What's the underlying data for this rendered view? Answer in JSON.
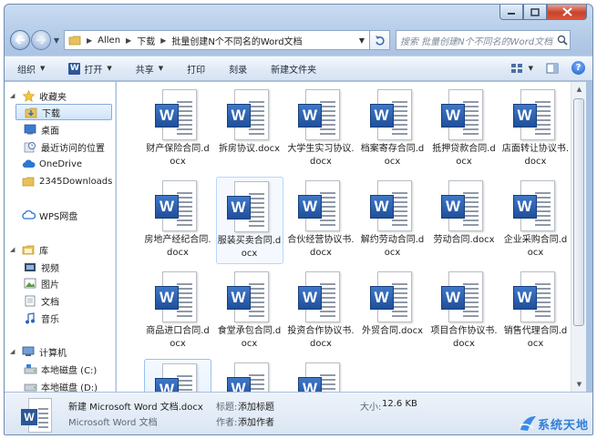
{
  "address": {
    "crumbs": [
      "Allen",
      "下载",
      "批量创建N个不同名的Word文档"
    ]
  },
  "search": {
    "placeholder": "搜索 批量创建N个不同名的Word文档"
  },
  "toolbar": {
    "organize": "组织",
    "open": "打开",
    "share": "共享",
    "print": "打印",
    "burn": "刻录",
    "new_folder": "新建文件夹"
  },
  "sidebar": {
    "favorites": "收藏夹",
    "downloads": "下载",
    "desktop": "桌面",
    "recent": "最近访问的位置",
    "onedrive": "OneDrive",
    "downloads2345": "2345Downloads",
    "wps": "WPS网盘",
    "libraries": "库",
    "videos": "视频",
    "pictures": "图片",
    "documents": "文档",
    "music": "音乐",
    "computer": "计算机",
    "drive_c": "本地磁盘 (C:)",
    "drive_d": "本地磁盘 (D:)"
  },
  "files": [
    "财产保险合同.docx",
    "拆房协议.docx",
    "大学生实习协议.docx",
    "档案寄存合同.docx",
    "抵押贷款合同.docx",
    "店面转让协议书.docx",
    "房地产经纪合同.docx",
    "服装买卖合同.docx",
    "合伙经营协议书.docx",
    "解约劳动合同.docx",
    "劳动合同.docx",
    "企业采购合同.docx",
    "商品进口合同.docx",
    "食堂承包合同.docx",
    "投资合作协议书.docx",
    "外贸合同.docx",
    "项目合作协议书.docx",
    "销售代理合同.docx"
  ],
  "details": {
    "filename": "新建 Microsoft Word 文档.docx",
    "filetype": "Microsoft Word 文档",
    "title_label": "标题:",
    "title_value": "添加标题",
    "author_label": "作者:",
    "author_value": "添加作者",
    "size_label": "大小:",
    "size_value": "12.6 KB"
  },
  "watermark": "系统天地",
  "colors": {
    "accent": "#2b5797",
    "selection": "#cfe4fa",
    "chrome": "#b7cde8"
  }
}
